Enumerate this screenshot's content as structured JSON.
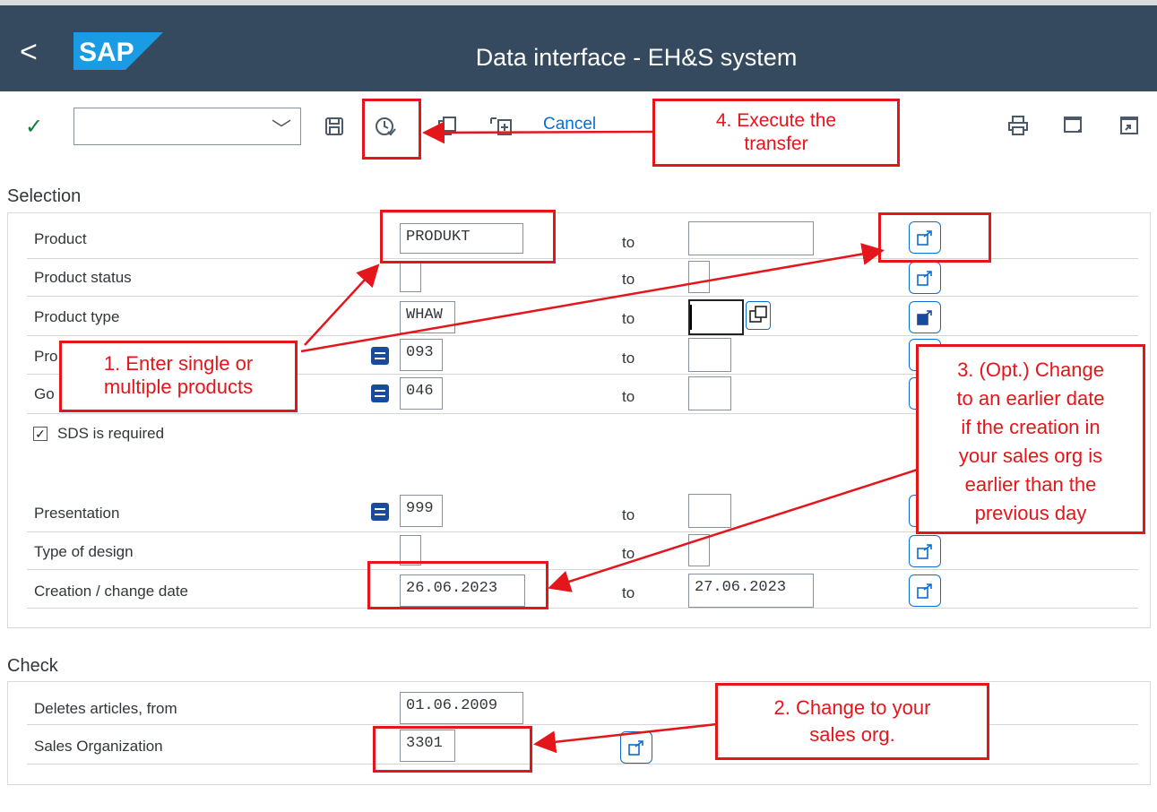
{
  "shell": {
    "back_label": "<",
    "logo_text": "SAP",
    "title": "Data interface - EH&S system"
  },
  "colors": {
    "shell": "#354a5f",
    "accent": "#0a6ed1",
    "annotation": "#e4151b",
    "check": "#107e3e"
  },
  "toolbar": {
    "check_icon": "check-icon",
    "command_field": {
      "value": "",
      "placeholder": ""
    },
    "save_icon": "save-icon",
    "execute_icon": "clock-execute-icon",
    "copy_icon": "copy-icon",
    "select_icon": "select-icon",
    "cancel_label": "Cancel",
    "right_icons": [
      "print-icon",
      "bookmark-icon",
      "new-window-icon"
    ]
  },
  "selection": {
    "title": "Selection",
    "to_label": "to",
    "rows": [
      {
        "label": "Product",
        "from": "PRODUKT",
        "to": ""
      },
      {
        "label": "Product status",
        "from": "",
        "to": ""
      },
      {
        "label": "Product type",
        "from": "WHAW",
        "to": ""
      },
      {
        "label": "Pro",
        "from": "093",
        "to": ""
      },
      {
        "label": "Go",
        "from": "046",
        "to": ""
      },
      {
        "label": "Presentation",
        "from": "999",
        "to": ""
      },
      {
        "label": "Type of design",
        "from": "",
        "to": ""
      },
      {
        "label": "Creation / change date",
        "from": "26.06.2023",
        "to": "27.06.2023"
      }
    ],
    "checkbox": {
      "label": "SDS is required",
      "checked": true
    }
  },
  "check": {
    "title": "Check",
    "rows": [
      {
        "label": "Deletes articles, from",
        "value": "01.06.2009"
      },
      {
        "label": "Sales Organization",
        "value": "3301"
      }
    ]
  },
  "annotations": {
    "step1": "1. Enter single or multiple products",
    "step1_l1": "1. Enter single or",
    "step1_l2": "multiple products",
    "step2_l1": "2. Change to your",
    "step2_l2": "sales org.",
    "step3_l1": "3. (Opt.) Change",
    "step3_l2": "to an earlier date",
    "step3_l3": "if the creation in",
    "step3_l4": "your sales org is",
    "step3_l5": "earlier than the",
    "step3_l6": "previous day",
    "step4_l1": "4. Execute the",
    "step4_l2": "transfer"
  }
}
